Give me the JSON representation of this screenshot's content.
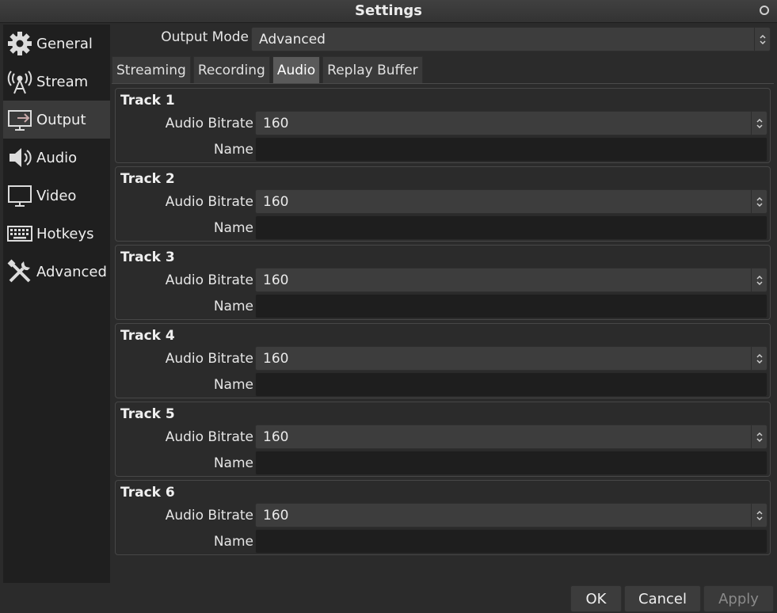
{
  "window": {
    "title": "Settings"
  },
  "sidebar": {
    "items": [
      {
        "label": "General",
        "icon": "gear-icon"
      },
      {
        "label": "Stream",
        "icon": "antenna-icon"
      },
      {
        "label": "Output",
        "icon": "output-monitor-icon",
        "active": true
      },
      {
        "label": "Audio",
        "icon": "speaker-icon"
      },
      {
        "label": "Video",
        "icon": "monitor-icon"
      },
      {
        "label": "Hotkeys",
        "icon": "keyboard-icon"
      },
      {
        "label": "Advanced",
        "icon": "tools-icon"
      }
    ]
  },
  "output": {
    "mode_label": "Output Mode",
    "mode_value": "Advanced",
    "tabs": [
      "Streaming",
      "Recording",
      "Audio",
      "Replay Buffer"
    ],
    "active_tab": "Audio",
    "tracks": [
      {
        "title": "Track 1",
        "bitrate_label": "Audio Bitrate",
        "bitrate": "160",
        "name_label": "Name",
        "name": ""
      },
      {
        "title": "Track 2",
        "bitrate_label": "Audio Bitrate",
        "bitrate": "160",
        "name_label": "Name",
        "name": ""
      },
      {
        "title": "Track 3",
        "bitrate_label": "Audio Bitrate",
        "bitrate": "160",
        "name_label": "Name",
        "name": ""
      },
      {
        "title": "Track 4",
        "bitrate_label": "Audio Bitrate",
        "bitrate": "160",
        "name_label": "Name",
        "name": ""
      },
      {
        "title": "Track 5",
        "bitrate_label": "Audio Bitrate",
        "bitrate": "160",
        "name_label": "Name",
        "name": ""
      },
      {
        "title": "Track 6",
        "bitrate_label": "Audio Bitrate",
        "bitrate": "160",
        "name_label": "Name",
        "name": ""
      }
    ]
  },
  "footer": {
    "ok": "OK",
    "cancel": "Cancel",
    "apply": "Apply"
  },
  "colors": {
    "background": "#2b2b2b",
    "sidebar": "#1f1f1f",
    "active_tab": "#5a5a5a",
    "input": "#1e1e1e"
  }
}
